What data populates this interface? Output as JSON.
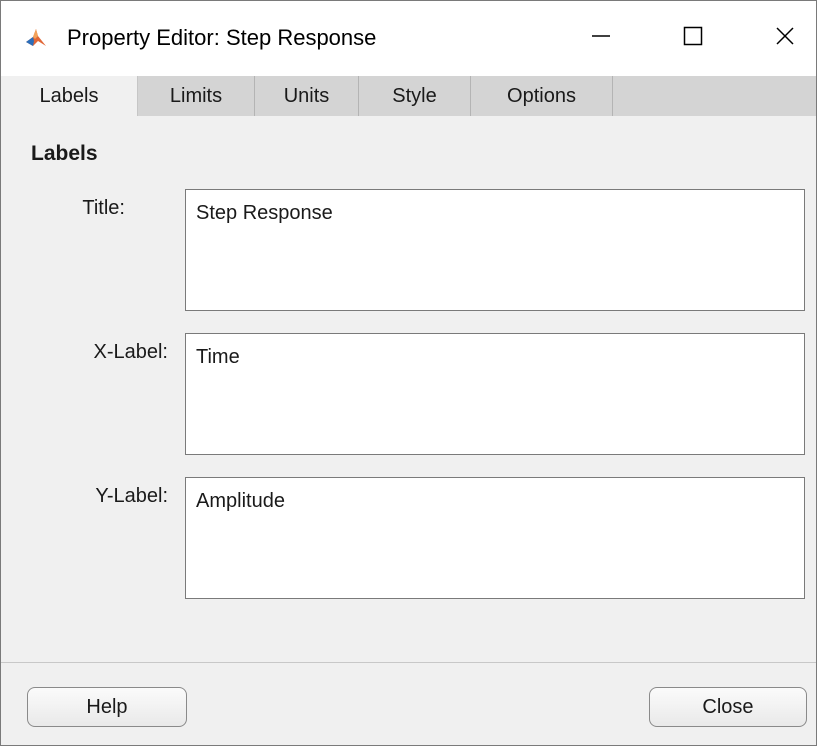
{
  "window": {
    "title": "Property Editor: Step Response",
    "icon": "matlab-logo-icon",
    "controls": {
      "minimize": "minimize-icon",
      "maximize": "maximize-icon",
      "close": "close-icon"
    }
  },
  "tabs": [
    {
      "label": "Labels",
      "active": true
    },
    {
      "label": "Limits",
      "active": false
    },
    {
      "label": "Units",
      "active": false
    },
    {
      "label": "Style",
      "active": false
    },
    {
      "label": "Options",
      "active": false
    }
  ],
  "panel": {
    "section_title": "Labels",
    "fields": {
      "title": {
        "label": "Title:",
        "value": "Step Response"
      },
      "xlabel": {
        "label": "X-Label:",
        "value": "Time"
      },
      "ylabel": {
        "label": "Y-Label:",
        "value": "Amplitude"
      }
    }
  },
  "footer": {
    "help_label": "Help",
    "close_label": "Close"
  }
}
